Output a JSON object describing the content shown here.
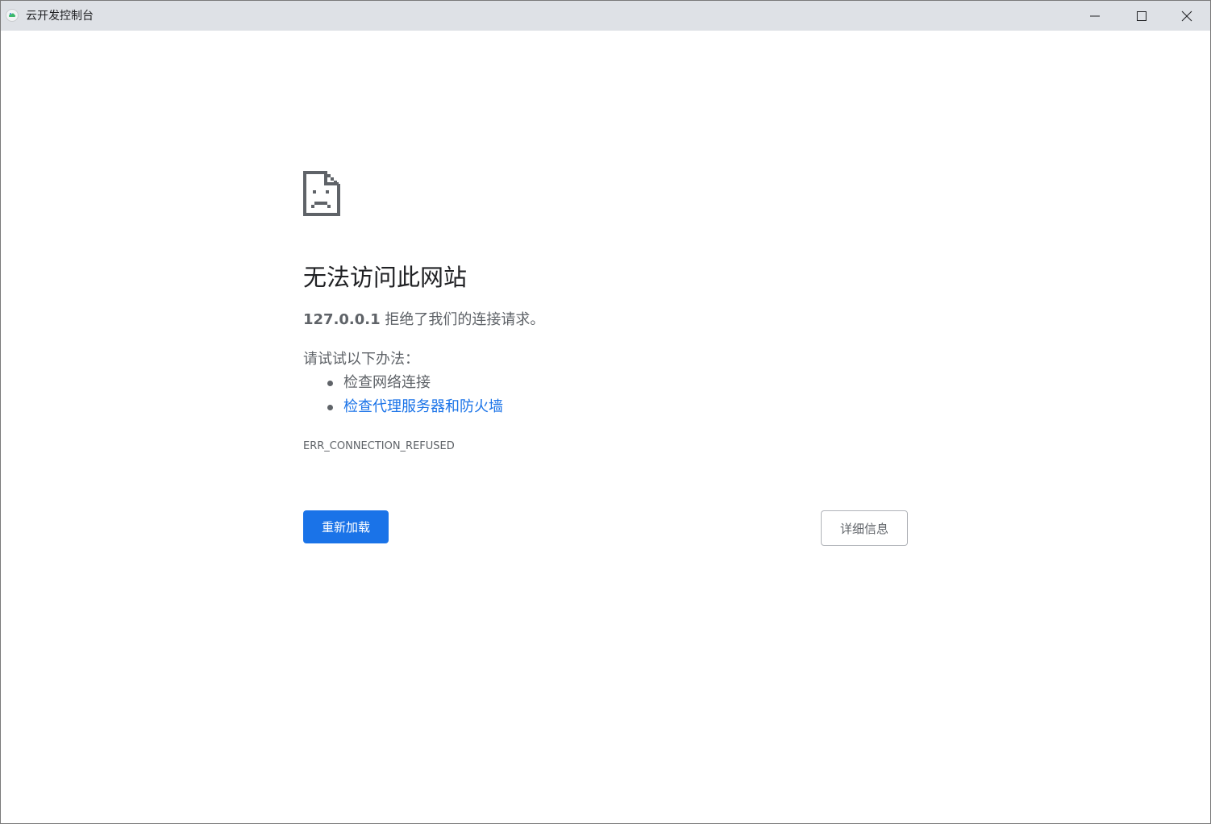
{
  "window": {
    "title": "云开发控制台",
    "icon": "cloud-dev-app-icon",
    "controls": {
      "minimize_icon": "minimize-icon",
      "maximize_icon": "maximize-icon",
      "close_icon": "close-icon"
    }
  },
  "error_page": {
    "icon": "sad-document-icon",
    "heading": "无法访问此网站",
    "host": "127.0.0.1",
    "message": " 拒绝了我们的连接请求。",
    "try_label": "请试试以下办法：",
    "suggestions": [
      {
        "label": "检查网络连接",
        "is_link": false
      },
      {
        "label": "检查代理服务器和防火墙",
        "is_link": true
      }
    ],
    "error_code": "ERR_CONNECTION_REFUSED",
    "reload_label": "重新加载",
    "details_label": "详细信息"
  },
  "colors": {
    "titlebar": "#dee1e6",
    "primary_button": "#1a73e8",
    "link": "#1a73e8",
    "text_secondary": "#5f6368",
    "heading": "#202124"
  }
}
